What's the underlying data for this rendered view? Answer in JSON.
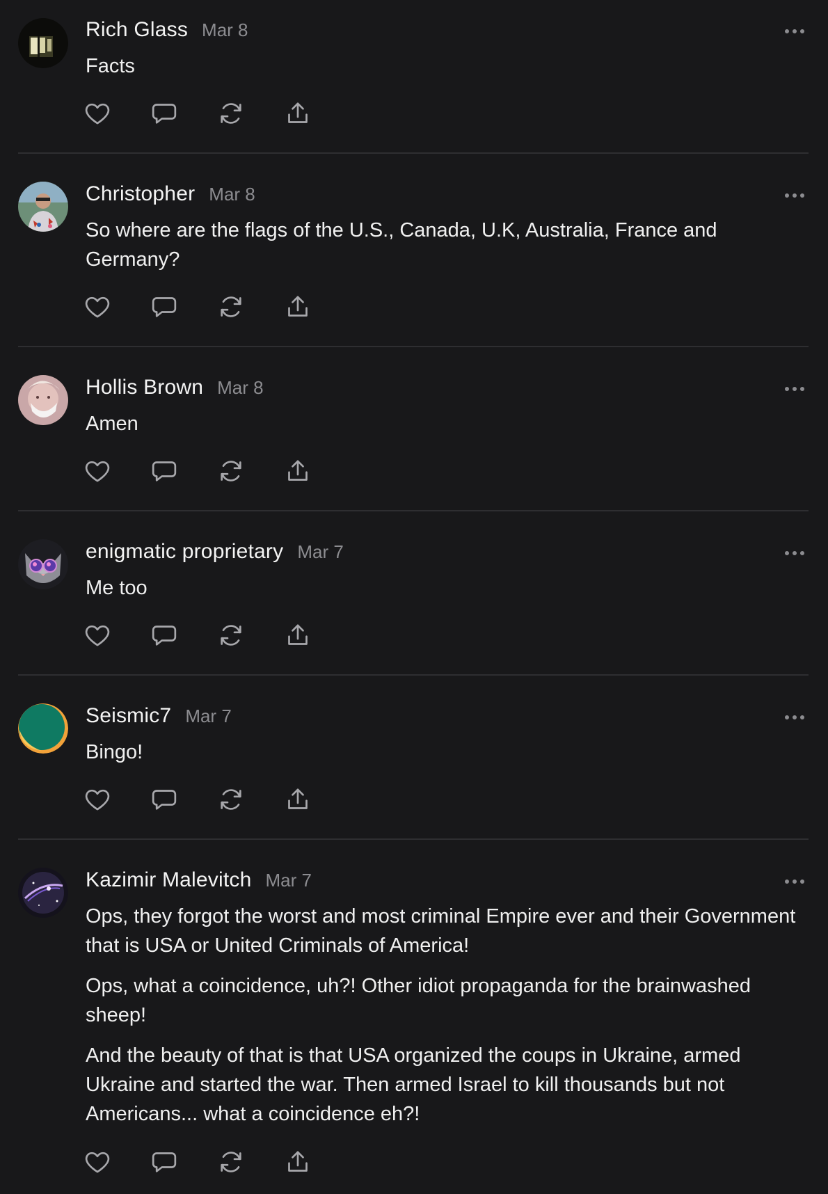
{
  "comments": [
    {
      "author": "Rich Glass",
      "date": "Mar 8",
      "paragraphs": [
        "Facts"
      ],
      "avatar_icon": "dark-window-photo"
    },
    {
      "author": "Christopher",
      "date": "Mar 8",
      "paragraphs": [
        "So where are the flags of the U.S., Canada, U.K, Australia, France and Germany?"
      ],
      "avatar_icon": "man-outdoor-photo"
    },
    {
      "author": "Hollis Brown",
      "date": "Mar 8",
      "paragraphs": [
        "Amen"
      ],
      "avatar_icon": "masked-face-photo"
    },
    {
      "author": "enigmatic proprietary",
      "date": "Mar 7",
      "paragraphs": [
        "Me too"
      ],
      "avatar_icon": "cat-glasses-photo"
    },
    {
      "author": "Seismic7",
      "date": "Mar 7",
      "paragraphs": [
        "Bingo!"
      ],
      "avatar_icon": "green-orange-circle-logo"
    },
    {
      "author": "Kazimir Malevitch",
      "date": "Mar 7",
      "paragraphs": [
        "Ops, they forgot the worst and most criminal Empire ever and their Government that is USA or United Criminals of America!",
        "Ops, what a coincidence, uh?! Other idiot propaganda for the brainwashed sheep!",
        "And the beauty of that is that USA organized the coups in Ukraine, armed Ukraine and started the war. Then armed Israel to kill thousands but not Americans... what a coincidence eh?!"
      ],
      "avatar_icon": "space-galaxy-photo"
    }
  ],
  "actions": [
    "heart-icon",
    "comment-icon",
    "restack-icon",
    "share-icon"
  ],
  "colors": {
    "background": "#18181a",
    "text_primary": "#f4f4f4",
    "text_secondary": "#8c8c90",
    "icon": "#a8a8ac",
    "divider": "#2e2e31"
  }
}
